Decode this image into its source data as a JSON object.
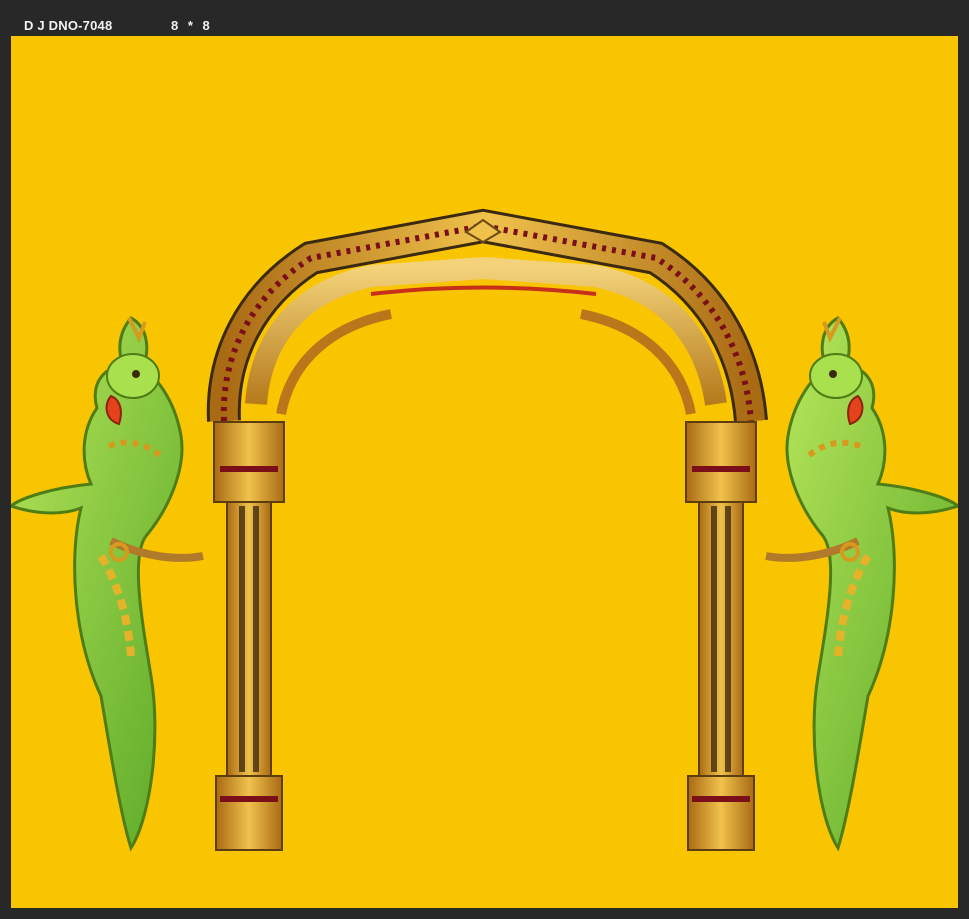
{
  "document": {
    "name": "D J DNO-7048",
    "size": "8  *  8"
  },
  "colors": {
    "canvas_background": "#f9c400",
    "chrome_background": "#282828",
    "gold": "#d79a1f",
    "parrot_green": "#7fd23a",
    "beak_red": "#e4421b"
  },
  "artwork": {
    "elements": [
      "ornate-arch",
      "left-pillar",
      "right-pillar",
      "left-parrot",
      "right-parrot"
    ]
  }
}
